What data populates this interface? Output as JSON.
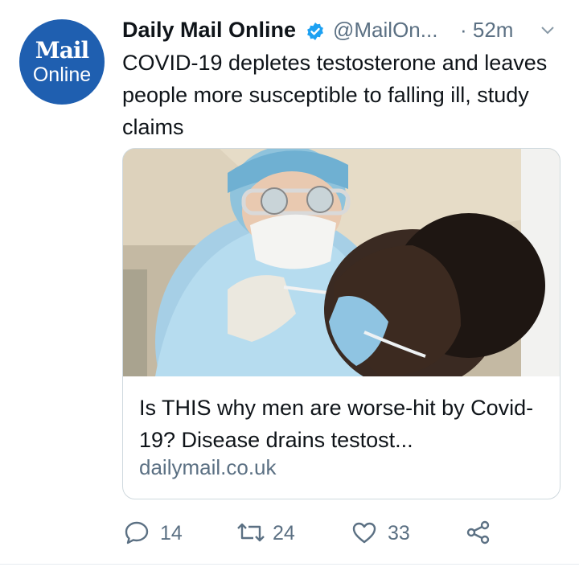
{
  "tweet": {
    "avatar": {
      "line1": "Mail",
      "line2": "Online"
    },
    "author_name": "Daily Mail Online",
    "handle": "@MailOn...",
    "time": "· 52m",
    "text": "COVID-19 depletes testosterone and leaves people more susceptible to falling ill, study claims",
    "card": {
      "title": "Is THIS why men are worse-hit by Covid-19? Disease drains testost...",
      "domain": "dailymail.co.uk"
    },
    "actions": {
      "replies": "14",
      "retweets": "24",
      "likes": "33"
    }
  },
  "colors": {
    "accent": "#1da1f2",
    "avatar_bg": "#1f5fb0",
    "muted": "#5b7083"
  },
  "icons": [
    "verified-badge-icon",
    "chevron-down-icon",
    "reply-icon",
    "retweet-icon",
    "like-icon",
    "share-icon"
  ]
}
